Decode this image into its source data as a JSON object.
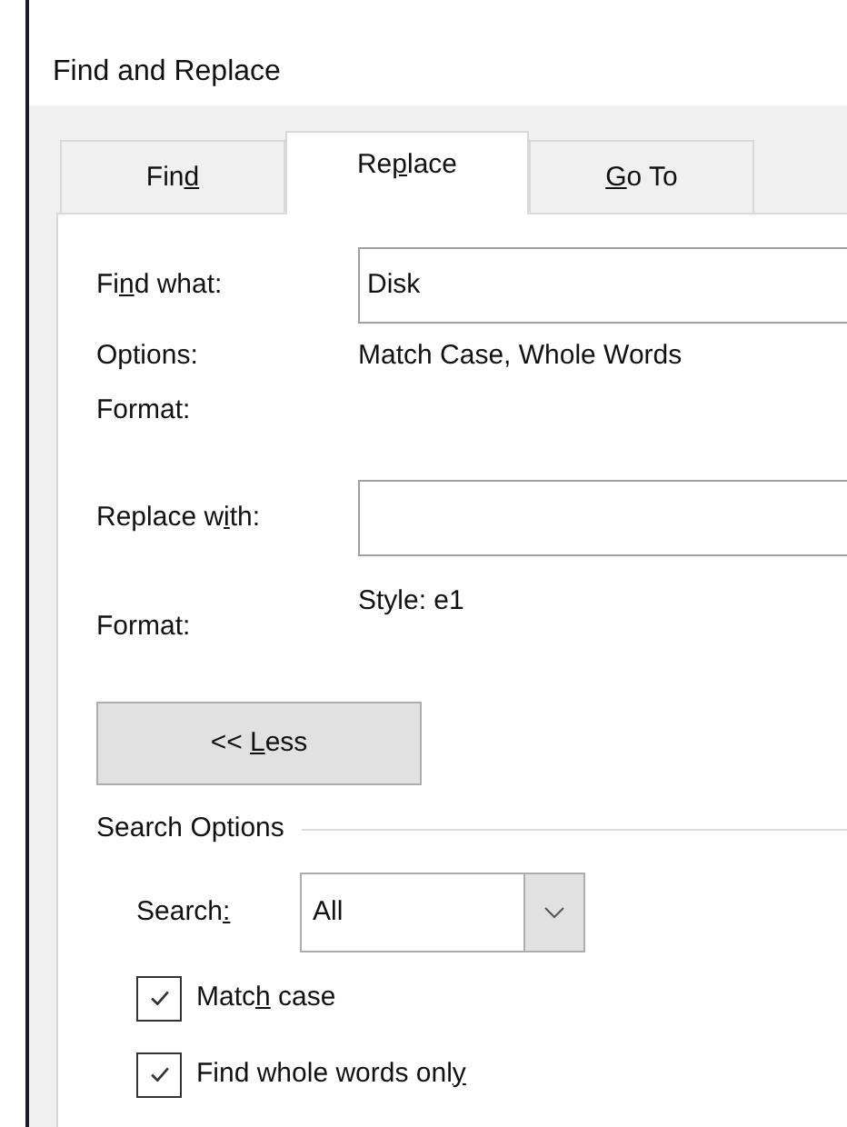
{
  "window": {
    "title": "Find and Replace"
  },
  "tabs": [
    {
      "label": {
        "before": "Fin",
        "key": "d"
      },
      "selected": false
    },
    {
      "label": {
        "before": "Re",
        "key": "p",
        "after": "lace"
      },
      "selected": true
    },
    {
      "label": {
        "key": "G",
        "after": "o To"
      },
      "selected": false
    }
  ],
  "find_what": {
    "label": {
      "before": "Fi",
      "key": "n",
      "after": "d what:"
    },
    "value": "Disk"
  },
  "options": {
    "label": "Options:",
    "value": "Match Case, Whole Words"
  },
  "find_format": {
    "label": "Format:"
  },
  "replace_with": {
    "label": {
      "before": "Replace w",
      "key": "i",
      "after": "th:"
    }
  },
  "replace_format": {
    "label": "Format:",
    "value": "Style: e1"
  },
  "less_button": {
    "label": {
      "before": "<< ",
      "key": "L",
      "after": "ess"
    }
  },
  "search_options": {
    "title": "Search Options",
    "search": {
      "label": {
        "before": "Search",
        "key": ":"
      },
      "value": "All"
    },
    "checkboxes": [
      {
        "label": {
          "before": "Matc",
          "key": "h",
          "after": " case"
        },
        "checked": true
      },
      {
        "label": {
          "before": "Find whole words onl",
          "key": "y"
        },
        "checked": true
      }
    ]
  }
}
